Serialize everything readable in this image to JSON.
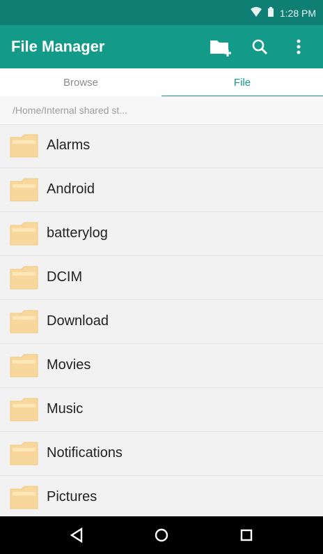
{
  "status": {
    "time": "1:28 PM",
    "icons": [
      "wifi-icon",
      "battery-icon"
    ]
  },
  "appbar": {
    "title": "File Manager",
    "actions": [
      "new-folder-icon",
      "search-icon",
      "overflow-menu-icon"
    ]
  },
  "tabs": {
    "browse": "Browse",
    "file": "File"
  },
  "path": "/Home/Internal shared st...",
  "folders": [
    "Alarms",
    "Android",
    "batterylog",
    "DCIM",
    "Download",
    "Movies",
    "Music",
    "Notifications",
    "Pictures"
  ],
  "navbar": {
    "icons": [
      "back-icon",
      "home-icon",
      "recent-apps-icon"
    ]
  },
  "colors": {
    "statusbar": "#0e7f72",
    "appbar": "#149a88",
    "folder": "#f7d79b",
    "accent": "#149a88"
  }
}
